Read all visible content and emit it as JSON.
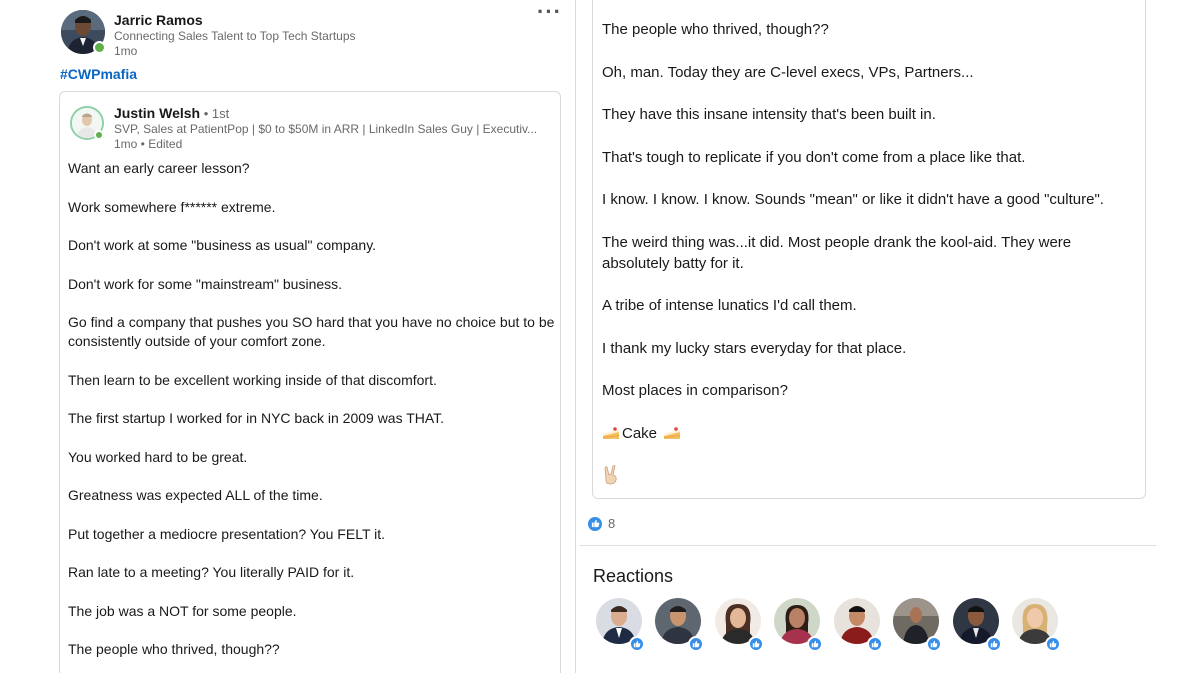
{
  "post": {
    "author": {
      "name": "Jarric Ramos",
      "headline": "Connecting Sales Talent to Top Tech Startups",
      "time": "1mo"
    },
    "hashtag": "#CWPmafia",
    "more_icon": "more-horizontal-icon"
  },
  "shared_post": {
    "author": {
      "name": "Justin Welsh",
      "degree": " • 1st",
      "headline": "SVP, Sales at PatientPop | $0 to $50M in ARR | LinkedIn Sales Guy | Executiv...",
      "time": "1mo • Edited"
    },
    "body_left": [
      "Want an early career lesson?",
      "Work somewhere f****** extreme.",
      "Don't work at some \"business as usual\" company.",
      "Don't work for some \"mainstream\" business.",
      "Go find a company that pushes you SO hard that you have no choice but to be consistently outside of your comfort zone.",
      "Then learn to be excellent working inside of that discomfort.",
      "The first startup I worked for in NYC back in 2009 was THAT.",
      "You worked hard to be great.",
      "Greatness was expected ALL of the time.",
      "Put together a mediocre presentation? You FELT it.",
      "Ran late to a meeting? You literally PAID for it.",
      "The job was a NOT for some people.",
      "The people who thrived, though??"
    ],
    "body_right": [
      "The people who thrived, though??",
      "Oh, man. Today they are C-level execs, VPs, Partners...",
      "They have this insane intensity that's been built in.",
      "That's tough to replicate if you don't come from a place like that.",
      "I know. I know. I know. Sounds \"mean\" or like it didn't have a good \"culture\".",
      "The weird thing was...it did. Most people drank the kool-aid. They were absolutely batty for it.",
      "A tribe of intense lunatics I'd call them.",
      "I thank my lucky stars everyday for that place.",
      "Most places in comparison?"
    ],
    "cake_text": "Cake"
  },
  "reactions": {
    "count": "8",
    "title": "Reactions",
    "like_color": "#378fe9"
  },
  "colors": {
    "hashtag": "#0a66c2",
    "online": "#5fb04a"
  }
}
